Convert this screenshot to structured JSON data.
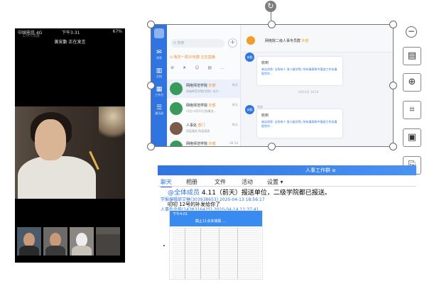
{
  "phone": {
    "carrier": "中国电信 4G",
    "time": "下午3:31",
    "battery": "67%",
    "ghost_text": "工作人员群",
    "speaking": "黄安勤 正在发言"
  },
  "im_screenshot": {
    "search_placeholder": "Q 搜索",
    "plus": "+",
    "notice": "⊙ 我交一周10天群 正在直播",
    "tools": [
      "⊕",
      "★",
      "☺",
      "▤",
      "…"
    ],
    "rail_items": [
      {
        "glyph": "✉",
        "label": "消息"
      },
      {
        "glyph": "▥",
        "label": "文档"
      },
      {
        "glyph": "▦",
        "label": "工作台"
      },
      {
        "glyph": "☰",
        "label": "通讯录"
      }
    ],
    "conversations": [
      {
        "name": "网络师范学院",
        "tag": "外部",
        "time": "昨天",
        "snippet": "网络师范学院(学院): 也不..."
      },
      {
        "name": "网络师范学院",
        "tag": "外部",
        "time": "昨天",
        "snippet": "(3位) 4月15日前事宜..."
      },
      {
        "name": "人事处",
        "tag": "部门",
        "time": "昨天",
        "snippet": "防疫服务 防疫报表"
      },
      {
        "name": "网络师范学院",
        "tag": "外部",
        "time": "04-14",
        "snippet": ""
      }
    ],
    "chat_title": "网络院二级人事专员群",
    "chat_tag": "外部",
    "messages": [
      {
        "avatar": "安勤",
        "who": "",
        "k1": "收到",
        "k2": "来自消息: 全所有人 各二级学院, 所有填表和中报部工作务填报完毕..."
      },
      {
        "avatar": "安勤",
        "who": "徐进",
        "k1": "收到",
        "k2": "来自消息: 全所有人 各二级学院, 所有填表和中报部工作务填报完毕..."
      }
    ],
    "timestamp": "4月14日 16:24"
  },
  "toolbar": {
    "rotate": "↻",
    "minus": "−",
    "tools": [
      {
        "name": "text-recognize-icon",
        "glyph": "▤"
      },
      {
        "name": "zoom-in-icon",
        "glyph": "⊕"
      },
      {
        "name": "crop-icon",
        "glyph": "⌗"
      },
      {
        "name": "image-icon",
        "glyph": "▣"
      },
      {
        "name": "export-icon",
        "glyph": "⎘"
      }
    ]
  },
  "group_chat": {
    "title": "人事工作群 ≥",
    "tabs": [
      "聊天",
      "相册",
      "文件",
      "活动",
      "设置 ▾"
    ],
    "post1_at": "@全体成员",
    "post1_text": " 4.11（前天）报送单位，二级学院都已报送。",
    "meta1": "学报编辑部艾琳(303938653) 2020-04-13 18:56:17",
    "post2": "叨叨  12号的补发给你了",
    "meta2": "人事处余俊(1438316425) 2020-04-14 11:37:41",
    "phone_time": "下午4:01",
    "phone_title": "截止11点未填报 …"
  }
}
